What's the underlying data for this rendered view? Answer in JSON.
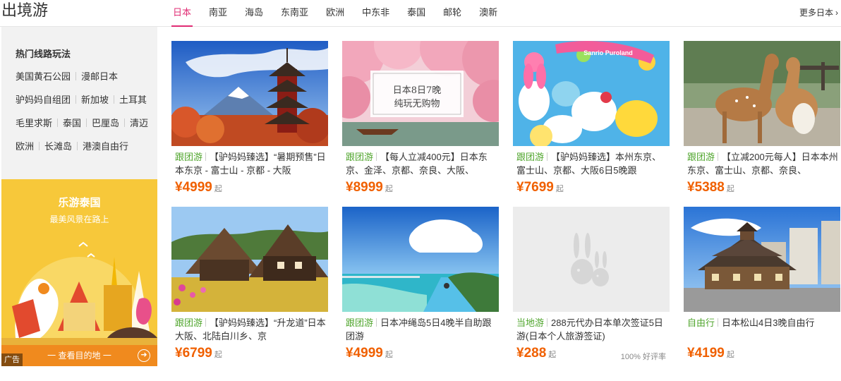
{
  "header": {
    "title": "出境游",
    "tabs": [
      {
        "label": "日本",
        "active": true
      },
      {
        "label": "南亚",
        "active": false
      },
      {
        "label": "海岛",
        "active": false
      },
      {
        "label": "东南亚",
        "active": false
      },
      {
        "label": "欧洲",
        "active": false
      },
      {
        "label": "中东非",
        "active": false
      },
      {
        "label": "泰国",
        "active": false
      },
      {
        "label": "邮轮",
        "active": false
      },
      {
        "label": "澳新",
        "active": false
      }
    ],
    "more_label": "更多日本",
    "more_icon": "chevron-right-icon"
  },
  "sidebar": {
    "title": "热门线路玩法",
    "rows": [
      [
        "美国黄石公园",
        "漫邮日本"
      ],
      [
        "驴妈妈自组团",
        "新加坡",
        "土耳其"
      ],
      [
        "毛里求斯",
        "泰国",
        "巴厘岛",
        "清迈"
      ],
      [
        "欧洲",
        "长滩岛",
        "港澳自由行"
      ]
    ]
  },
  "ad": {
    "title": "乐游泰国",
    "subtitle": "最美风景在路上",
    "cta": "一 查看目的地 一",
    "label": "广告",
    "colors": {
      "background": "#f7c83a",
      "bar": "#f08a1e"
    }
  },
  "products": [
    {
      "tag": "跟团游",
      "title": "【驴妈妈臻选】“暑期预售”日本东京 - 富士山 - 京都 - 大阪",
      "price": "¥4999",
      "price_unit": "起",
      "image": "fuji-pagoda"
    },
    {
      "tag": "跟团游",
      "title": "【每人立减400元】日本东京、金泽、京都、奈良、大阪、",
      "price": "¥8999",
      "price_unit": "起",
      "image": "cherry-blossom-river",
      "image_text": [
        "日本8日7晚",
        "纯玩无购物"
      ]
    },
    {
      "tag": "跟团游",
      "title": "【驴妈妈臻选】本州东京、富士山、京都、大阪6日5晚跟",
      "price": "¥7699",
      "price_unit": "起",
      "image": "sanrio-puroland",
      "image_text": [
        "Sanrio Puroland"
      ]
    },
    {
      "tag": "跟团游",
      "title": "【立减200元每人】日本本州东京、富士山、京都、奈良、",
      "price": "¥5388",
      "price_unit": "起",
      "image": "nara-deer"
    },
    {
      "tag": "跟团游",
      "title": "【驴妈妈臻选】“升龙道”日本大阪、北陆白川乡、京",
      "price": "¥6799",
      "price_unit": "起",
      "image": "shirakawa-go"
    },
    {
      "tag": "跟团游",
      "title": "日本冲绳岛5日4晚半自助跟团游",
      "price": "¥4999",
      "price_unit": "起",
      "image": "okinawa-beach"
    },
    {
      "tag": "当地游",
      "title": "288元代办日本单次签证5日游(日本个人旅游签证)",
      "price": "¥288",
      "price_unit": "起",
      "image": "placeholder-rabbit",
      "rating": "100% 好评率"
    },
    {
      "tag": "自由行",
      "title": "日本松山4日3晚自由行",
      "price": "¥4199",
      "price_unit": "起",
      "image": "dogo-onsen"
    }
  ],
  "colors": {
    "accent": "#e02c74",
    "price": "#f06000",
    "tag": "#4fa52c"
  }
}
